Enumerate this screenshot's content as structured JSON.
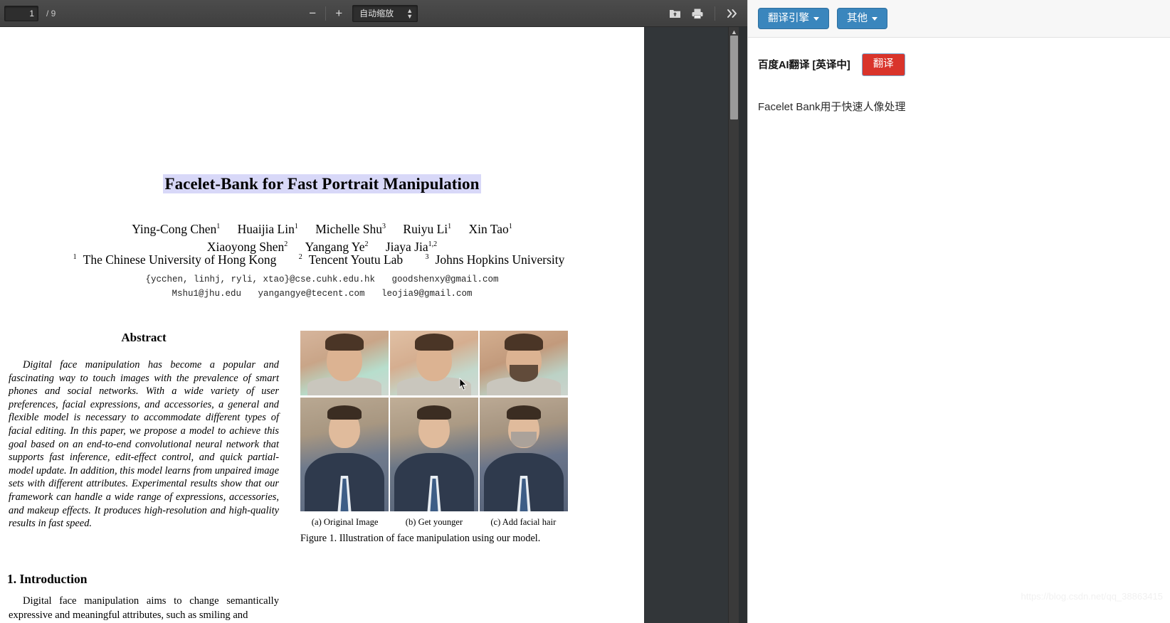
{
  "viewer": {
    "page_number": "1",
    "page_total": "/ 9",
    "zoom_out_label": "−",
    "zoom_in_label": "+",
    "zoom_level": "自动缩放",
    "save_icon": "save-download-icon",
    "print_icon": "printer-icon",
    "more_tools_icon": "double-chevron-right-icon",
    "scroll_up_icon": "triangle-up-icon"
  },
  "paper": {
    "title": "Facelet-Bank for Fast Portrait Manipulation",
    "authors_line1": [
      {
        "name": "Ying-Cong Chen",
        "sup": "1"
      },
      {
        "name": "Huaijia Lin",
        "sup": "1"
      },
      {
        "name": "Michelle Shu",
        "sup": "3"
      },
      {
        "name": "Ruiyu Li",
        "sup": "1"
      },
      {
        "name": "Xin Tao",
        "sup": "1"
      }
    ],
    "authors_line2": [
      {
        "name": "Xiaoyong Shen",
        "sup": "2"
      },
      {
        "name": "Yangang Ye",
        "sup": "2"
      },
      {
        "name": "Jiaya Jia",
        "sup": "1,2"
      }
    ],
    "affiliations": [
      {
        "sup": "1",
        "name": "The Chinese University of Hong Kong"
      },
      {
        "sup": "2",
        "name": "Tencent Youtu Lab"
      },
      {
        "sup": "3",
        "name": "Johns Hopkins University"
      }
    ],
    "emails_line1": [
      "{ycchen, linhj, ryli, xtao}@cse.cuhk.edu.hk",
      "goodshenxy@gmail.com"
    ],
    "emails_line2": [
      "Mshu1@jhu.edu",
      "yangangye@tecent.com",
      "leojia9@gmail.com"
    ],
    "abstract_heading": "Abstract",
    "abstract_body": "Digital face manipulation has become a popular and fascinating way to touch images with the prevalence of smart phones and social networks. With a wide variety of user preferences, facial expressions, and accessories, a general and flexible model is necessary to accommodate different types of facial editing. In this paper, we propose a model to achieve this goal based on an end-to-end convolutional neural network that supports fast inference, edit-effect control, and quick partial-model update. In addition, this model learns from unpaired image sets with different attributes. Experimental results show that our framework can handle a wide range of expressions, accessories, and makeup effects. It produces high-resolution and high-quality results in fast speed.",
    "section_heading": "1. Introduction",
    "section_body": "Digital face manipulation aims to change semantically expressive and meaningful attributes, such as smiling and",
    "figure": {
      "sub_captions": [
        "(a) Original Image",
        "(b) Get younger",
        "(c) Add facial hair"
      ],
      "caption": "Figure 1. Illustration of face manipulation using our model."
    }
  },
  "translate_panel": {
    "engine_button": "翻译引擎",
    "other_button": "其他",
    "header_title": "百度AI翻译 [英译中]",
    "translate_button": "翻译",
    "translated_text": "Facelet Bank用于快速人像处理"
  },
  "watermark": "https://blog.csdn.net/qq_38863415",
  "colors": {
    "accent_blue": "#3a86bd",
    "accent_red": "#d9342b",
    "selection_highlight": "#d8d8f8",
    "toolbar_dark": "#474747"
  }
}
